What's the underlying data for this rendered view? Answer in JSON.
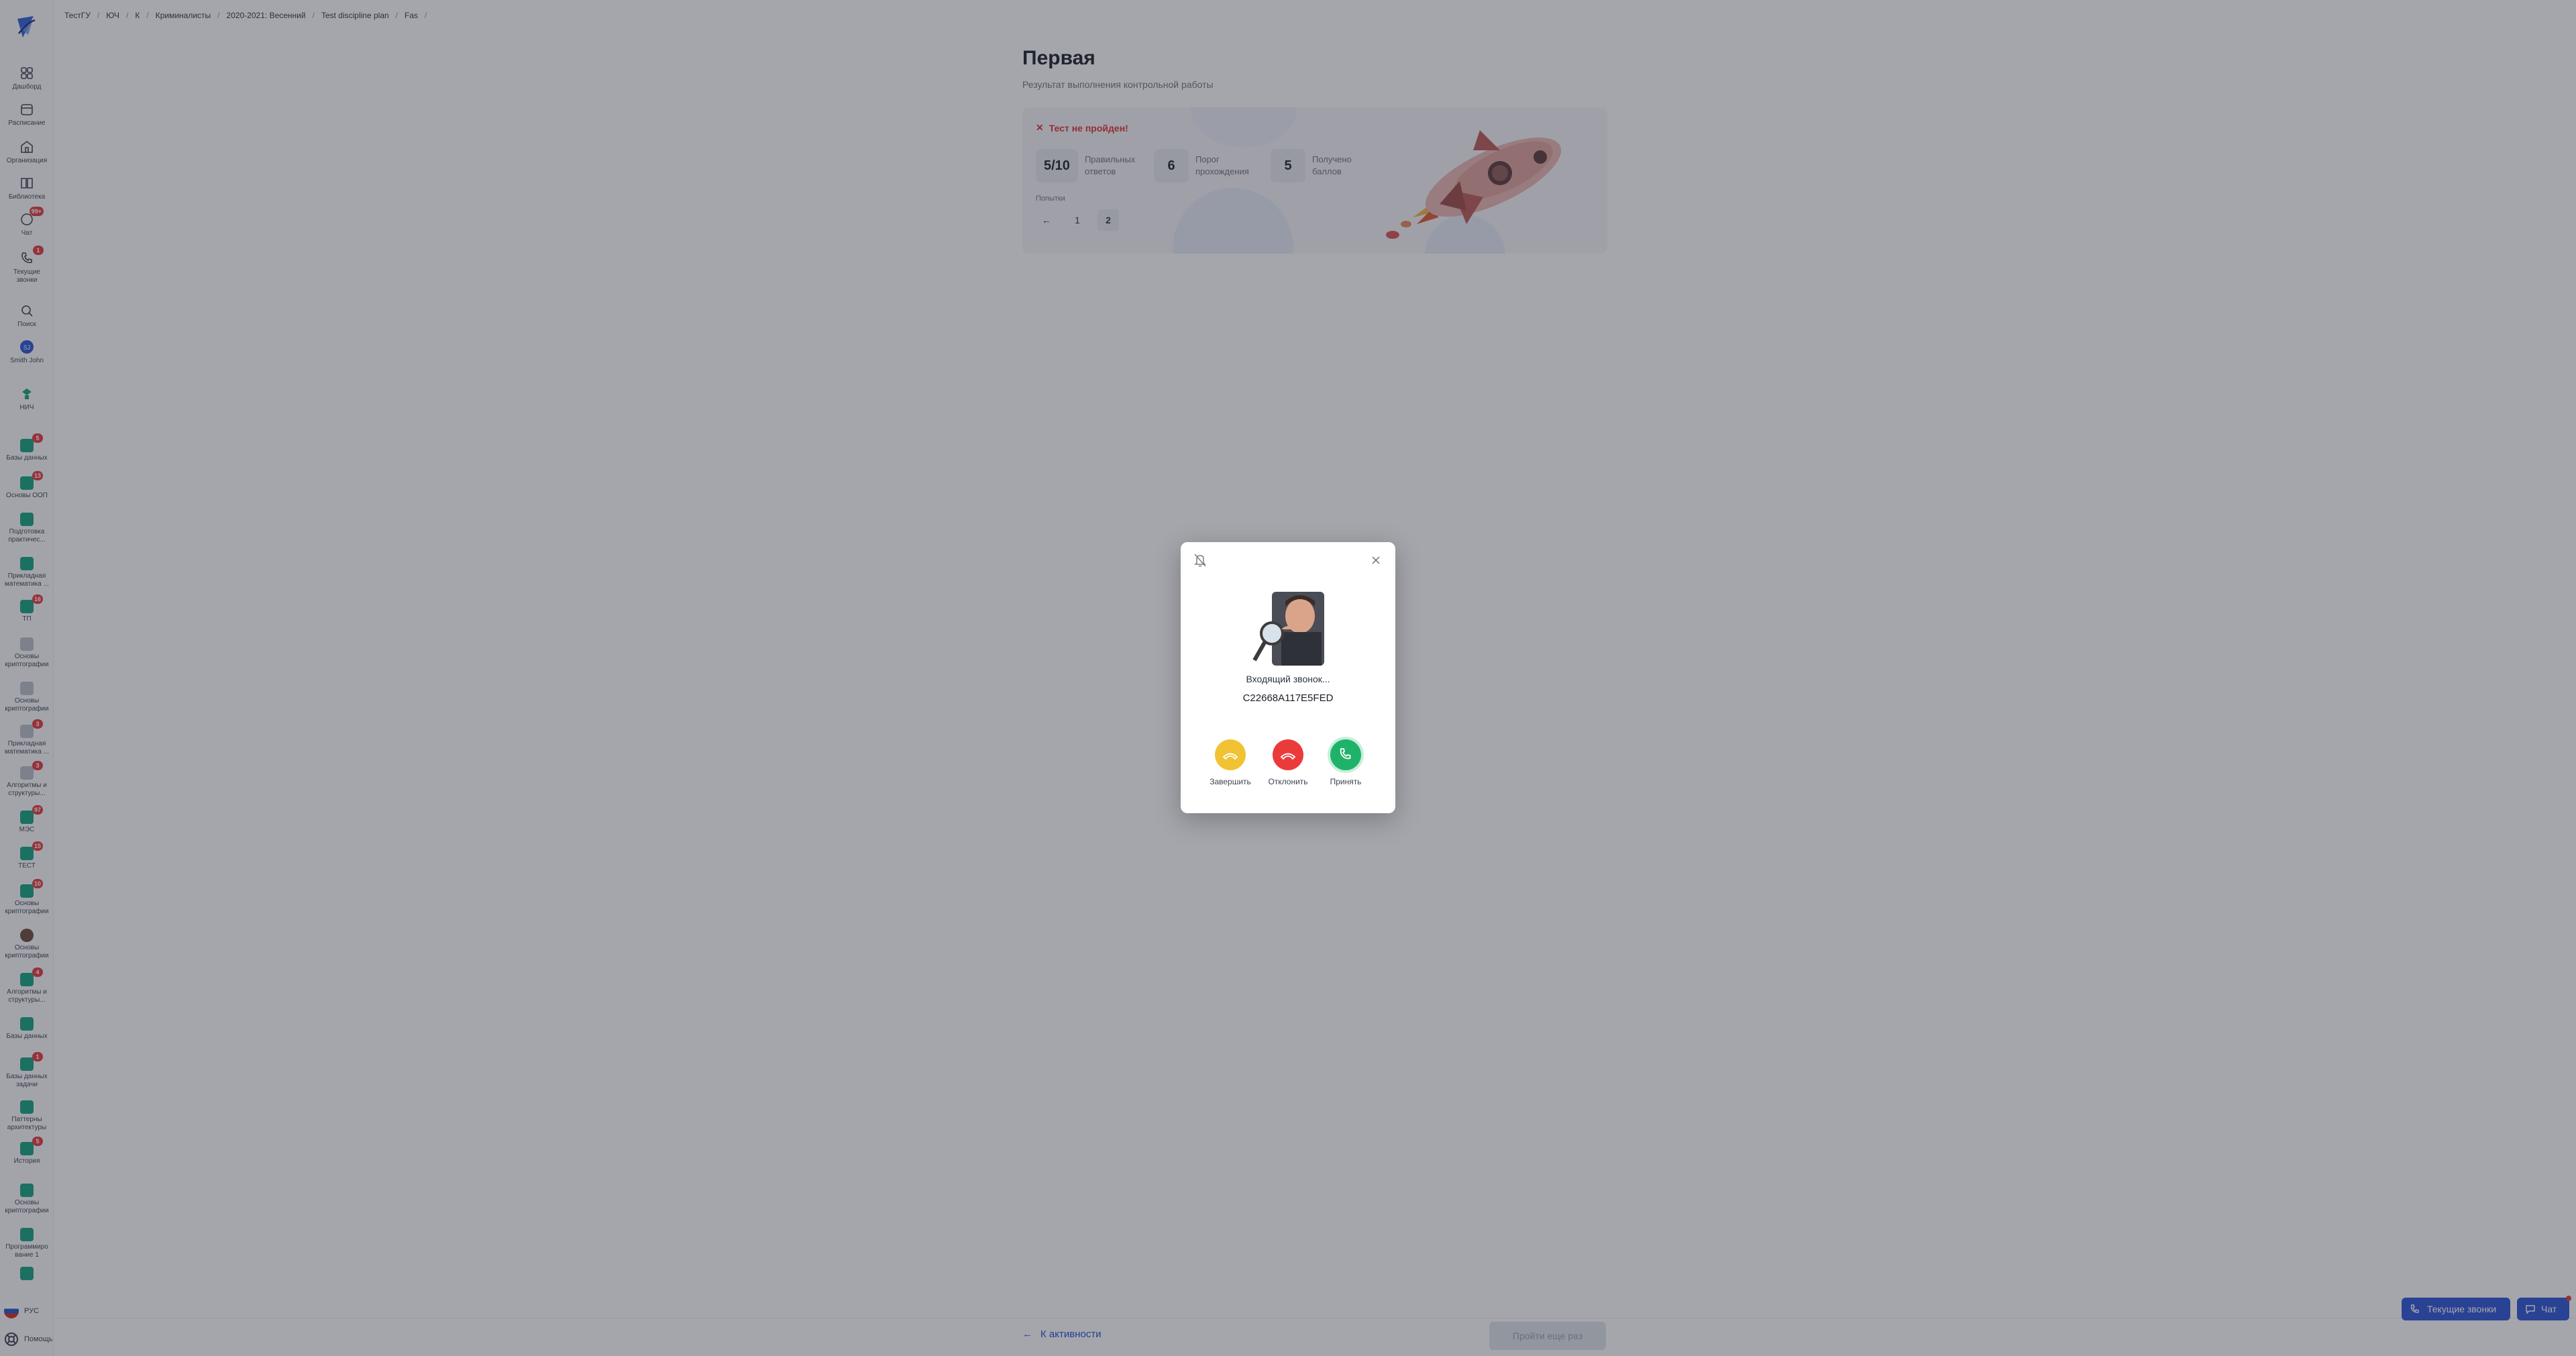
{
  "breadcrumb": [
    "ТестГУ",
    "ЮЧ",
    "К",
    "Криминалисты",
    "2020-2021: Весенний",
    "Test discipline plan",
    "Fas"
  ],
  "sidebar": {
    "nav": [
      {
        "label": "Дашборд",
        "icon": "dashboard-icon"
      },
      {
        "label": "Расписание",
        "icon": "calendar-icon"
      },
      {
        "label": "Организация",
        "icon": "organization-icon"
      },
      {
        "label": "Библиотека",
        "icon": "library-icon"
      },
      {
        "label": "Чат",
        "icon": "chat-icon",
        "badge": "99+"
      },
      {
        "label": "Текущие звонки",
        "icon": "phone-icon",
        "badge": "1"
      },
      {
        "label": "Поиск",
        "icon": "search-icon"
      },
      {
        "label": "Smith John",
        "icon": "profile-icon"
      },
      {
        "label": "НИЧ",
        "icon": "nich-icon"
      }
    ],
    "courses": [
      {
        "label": "Базы данных",
        "badge": "5"
      },
      {
        "label": "Основы ООП",
        "badge": "13"
      },
      {
        "label": "Подготовка\nпрактичес..."
      },
      {
        "label": "Прикладная\nматематика ..."
      },
      {
        "label": "ТП",
        "badge": "16"
      },
      {
        "label": "Основы\nкриптографии",
        "style": "gray"
      },
      {
        "label": "Основы\nкриптографии",
        "style": "gray"
      },
      {
        "label": "Прикладная\nматематика ...",
        "style": "gray",
        "badge": "3"
      },
      {
        "label": "Алгоритмы и\nструктуры...",
        "style": "gray",
        "badge": "3"
      },
      {
        "label": "МЭС",
        "badge": "97"
      },
      {
        "label": "ТЕСТ",
        "badge": "15"
      },
      {
        "label": "Основы\nкриптографии",
        "badge": "10"
      },
      {
        "label": "Основы\nкриптографии",
        "style": "avatar"
      },
      {
        "label": "Алгоритмы и\nструктуры...",
        "badge": "4"
      },
      {
        "label": "Базы данных"
      },
      {
        "label": "Базы данных\nзадачи",
        "badge": "1"
      },
      {
        "label": "Паттерны\nархитектуры"
      },
      {
        "label": "История",
        "badge": "5"
      },
      {
        "label": "Основы\nкриптографии"
      },
      {
        "label": "Программиро\nвание 1"
      },
      {
        "label": ""
      }
    ],
    "language": "РУС",
    "help": "Помощь"
  },
  "main": {
    "title": "Первая",
    "subtitle": "Результат выполнения контрольной работы",
    "status": "Тест не пройден!",
    "stats": [
      {
        "value": "5/10",
        "label": "Правильных\nответов"
      },
      {
        "value": "6",
        "label": "Порог\nпрохождения"
      },
      {
        "value": "5",
        "label": "Получено\nбаллов"
      }
    ],
    "attempts_label": "Попытки",
    "attempts": [
      "1",
      "2"
    ],
    "active_attempt": "2"
  },
  "footer": {
    "back_label": "К активности",
    "submit_label": "Пройти еще раз"
  },
  "floating": {
    "calls_label": "Текущие звонки",
    "chat_label": "Чат"
  },
  "call_modal": {
    "status": "Входящий звонок...",
    "caller_id": "C22668A117E5FED",
    "actions": [
      {
        "label": "Завершить",
        "color": "#f1c232"
      },
      {
        "label": "Отклонить",
        "color": "#ea3a3a"
      },
      {
        "label": "Принять",
        "color": "#1fb36a"
      }
    ]
  },
  "colors": {
    "accent": "#2a54d4",
    "success": "#14a37f",
    "danger": "#e02f2f"
  }
}
